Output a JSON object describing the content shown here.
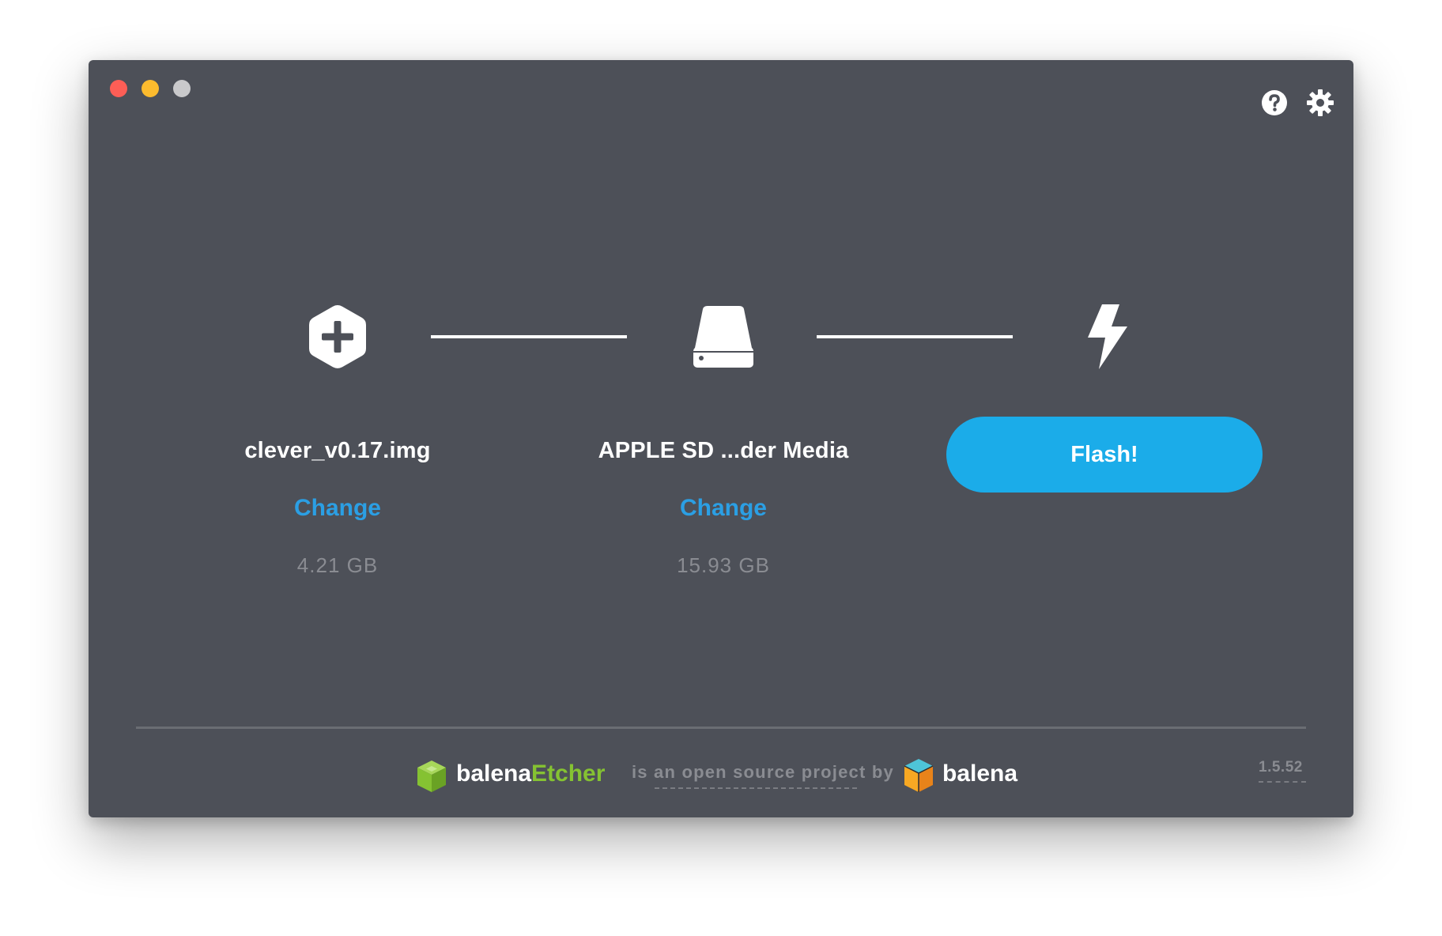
{
  "window": {
    "traffic_lights": [
      "close",
      "minimize",
      "maximize"
    ]
  },
  "toolbar": {
    "help_icon": "question-circle-icon",
    "settings_icon": "gear-icon"
  },
  "steps": [
    {
      "icon": "hexagon-plus-icon",
      "title": "clever_v0.17.img",
      "change_label": "Change",
      "size": "4.21 GB"
    },
    {
      "icon": "drive-icon",
      "title": "APPLE SD ...der Media",
      "change_label": "Change",
      "size": "15.93 GB"
    },
    {
      "icon": "lightning-icon",
      "button_label": "Flash!"
    }
  ],
  "footer": {
    "etcher_brand_1": "balena",
    "etcher_brand_2": "Etcher",
    "text": "is an open source project by",
    "balena_brand": "balena",
    "version": "1.5.52"
  },
  "colors": {
    "background": "#4d5058",
    "accent": "#1bace9",
    "link": "#2b9fe4",
    "etcher_green": "#85c232"
  }
}
